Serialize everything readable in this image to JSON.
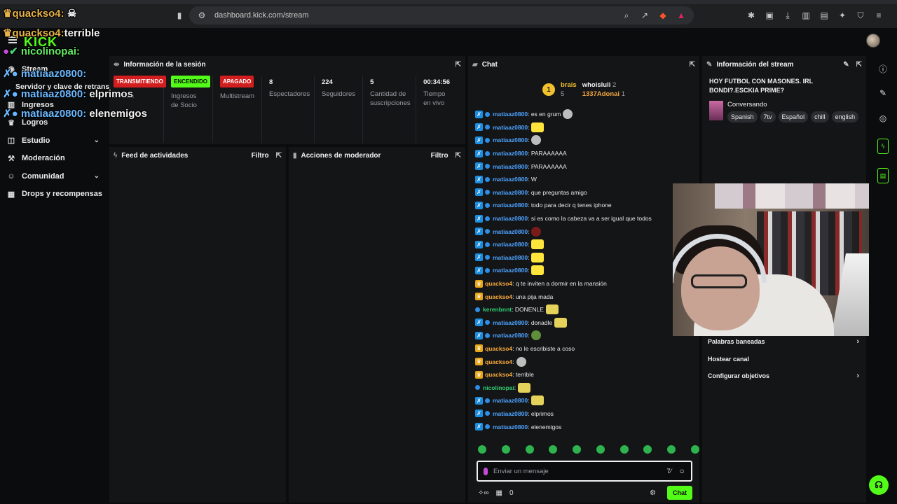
{
  "browser": {
    "url": "dashboard.kick.com/stream"
  },
  "app": {
    "logo": "KICK"
  },
  "overlay": [
    {
      "user": "quackso4:",
      "text": ""
    },
    {
      "user": "quackso4:",
      "text": "terrible"
    },
    {
      "user": "nicolinopai:",
      "text": ""
    },
    {
      "user": "matiaaz0800:",
      "text": ""
    },
    {
      "user": "matiaaz0800:",
      "text": "elprimos"
    },
    {
      "user": "matiaaz0800:",
      "text": "elenemigos"
    }
  ],
  "sidebar": {
    "items": [
      {
        "label": "Stream",
        "icon": "broadcast-icon"
      },
      {
        "label": "Servidor y clave de retransm",
        "icon": ""
      },
      {
        "label": "Ingresos",
        "icon": "chart-icon"
      },
      {
        "label": "Logros",
        "icon": "trophy-icon"
      },
      {
        "label": "Estudio",
        "icon": "studio-icon",
        "has_chevron": true
      },
      {
        "label": "Moderación",
        "icon": "wrench-icon"
      },
      {
        "label": "Comunidad",
        "icon": "people-icon",
        "has_chevron": true
      },
      {
        "label": "Drops y recompensas",
        "icon": "gift-icon"
      }
    ]
  },
  "session": {
    "title": "Información de la sesión",
    "stats": [
      {
        "badge": "TRANSMITIENDO",
        "badge_color": "red",
        "label": "Sesión"
      },
      {
        "badge": "ENCENDIDO",
        "badge_color": "green",
        "label": "Ingresos de Socio"
      },
      {
        "badge": "APAGADO",
        "badge_color": "red",
        "label": "Multistream"
      },
      {
        "value": "8",
        "label": "Espectadores"
      },
      {
        "value": "224",
        "label": "Seguidores"
      },
      {
        "value": "5",
        "label": "Cantidad de suscripciones"
      },
      {
        "value": "00:34:56",
        "label": "Tiempo en vivo"
      }
    ]
  },
  "activity_feed": {
    "title": "Feed de actividades",
    "filter": "Filtro"
  },
  "mod_actions": {
    "title": "Acciones de moderador",
    "filter": "Filtro"
  },
  "chat": {
    "title": "Chat",
    "leaderboard": {
      "first": {
        "rank": "1",
        "name": "brais",
        "count": "5"
      },
      "second": {
        "name": "whoisluli",
        "count": "2"
      },
      "third": {
        "name": "1337Adonai",
        "count": "1"
      }
    },
    "messages": [
      {
        "user": "matiaaz0800",
        "color": "blue",
        "badge": "mod",
        "text": ": es en grum",
        "emote": "w"
      },
      {
        "user": "matiaaz0800",
        "color": "blue",
        "badge": "mod",
        "text": ":",
        "emote": "y"
      },
      {
        "user": "matiaaz0800",
        "color": "blue",
        "badge": "mod",
        "text": ":",
        "emote": "w"
      },
      {
        "user": "matiaaz0800",
        "color": "blue",
        "badge": "mod",
        "text": ": PARAAAAAA"
      },
      {
        "user": "matiaaz0800",
        "color": "blue",
        "badge": "mod",
        "text": ": PARAAAAAA"
      },
      {
        "user": "matiaaz0800",
        "color": "blue",
        "badge": "mod",
        "text": ": W"
      },
      {
        "user": "matiaaz0800",
        "color": "blue",
        "badge": "mod",
        "text": ": que preguntas amigo"
      },
      {
        "user": "matiaaz0800",
        "color": "blue",
        "badge": "mod",
        "text": ": todo para decir q tenes iphone"
      },
      {
        "user": "matiaaz0800",
        "color": "blue",
        "badge": "mod",
        "text": ": si es como la cabeza va a ser igual que todos"
      },
      {
        "user": "matiaaz0800",
        "color": "blue",
        "badge": "mod",
        "text": ":",
        "emote": "r"
      },
      {
        "user": "matiaaz0800",
        "color": "blue",
        "badge": "mod",
        "text": ":",
        "emote": "y"
      },
      {
        "user": "matiaaz0800",
        "color": "blue",
        "badge": "mod",
        "text": ":",
        "emote": "y"
      },
      {
        "user": "matiaaz0800",
        "color": "blue",
        "badge": "mod",
        "text": ":",
        "emote": "y"
      },
      {
        "user": "quackso4",
        "color": "orange",
        "badge": "crown",
        "text": ": q te inviten a dormir en la mansión"
      },
      {
        "user": "quackso4",
        "color": "orange",
        "badge": "crown",
        "text": ": una pija mada"
      },
      {
        "user": "kerenbnnt",
        "color": "green",
        "badge": "none",
        "text": ": DONENLE",
        "emote": "sb"
      },
      {
        "user": "matiaaz0800",
        "color": "blue",
        "badge": "mod",
        "text": ": donadle",
        "emote": "sb"
      },
      {
        "user": "matiaaz0800",
        "color": "blue",
        "badge": "mod",
        "text": ":",
        "emote": "g"
      },
      {
        "user": "quackso4",
        "color": "orange",
        "badge": "crown",
        "text": ": no le escribiste a coso"
      },
      {
        "user": "quackso4",
        "color": "orange",
        "badge": "crown",
        "text": ":",
        "emote": "w"
      },
      {
        "user": "quackso4",
        "color": "orange",
        "badge": "crown",
        "text": ": terrible"
      },
      {
        "user": "nicolinopai",
        "color": "green",
        "badge": "none",
        "text": ":",
        "emote": "sb"
      },
      {
        "user": "matiaaz0800",
        "color": "blue",
        "badge": "mod",
        "text": ":",
        "emote": "sb"
      },
      {
        "user": "matiaaz0800",
        "color": "blue",
        "badge": "mod",
        "text": ": elprimos"
      },
      {
        "user": "matiaaz0800",
        "color": "blue",
        "badge": "mod",
        "text": ": elenemigos"
      }
    ],
    "input_placeholder": "Enviar un mensaje",
    "points": "0",
    "send_label": "Chat"
  },
  "stream_info": {
    "title": "Información del stream",
    "stream_title": "HOY FUTBOL CON MASONES. IRL BONDI?.ESCKIA PRIME?",
    "category": "Conversando",
    "tags": [
      "Spanish",
      "7tv",
      "Español",
      "chill",
      "english"
    ],
    "settings": [
      {
        "label": "Palabras baneadas",
        "chevron": true
      },
      {
        "label": "Hostear canal",
        "chevron": false
      },
      {
        "label": "Configurar objetivos",
        "chevron": true
      }
    ]
  }
}
